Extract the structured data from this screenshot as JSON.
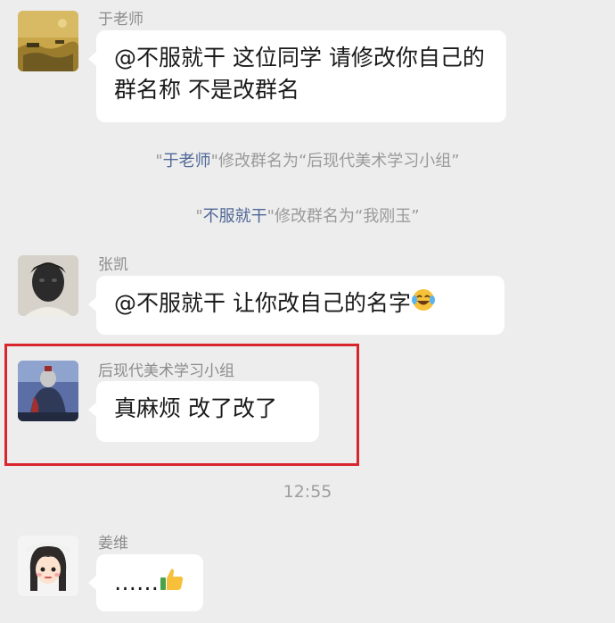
{
  "messages": [
    {
      "sender": "于老师",
      "avatar_icon": "landscape-painting-avatar",
      "text": "@不服就干 这位同学 请修改你自己的群名称 不是改群名"
    },
    {
      "sender": "张凯",
      "avatar_icon": "face-mask-avatar",
      "text": "@不服就干 让你改自己的名字",
      "emoji": "laughing-tears-emoji"
    },
    {
      "sender": "后现代美术学习小组",
      "avatar_icon": "armored-figure-avatar",
      "text": "真麻烦 改了改了"
    },
    {
      "sender": "姜维",
      "avatar_icon": "cartoon-girl-avatar",
      "text": "……",
      "emoji": "thumbs-up-emoji"
    }
  ],
  "system_notices": [
    {
      "q1": "\"",
      "name": "于老师",
      "text": "\"修改群名为“后现代美术学习小组”"
    },
    {
      "q1": "\"",
      "name": "不服就干",
      "text": "\"修改群名为“我刚玉”"
    }
  ],
  "timestamp": "12:55",
  "highlight_color": "#d9262c",
  "name_link_color": "#4f6896",
  "bubble_color": "#ffffff",
  "background_color": "#ededed"
}
